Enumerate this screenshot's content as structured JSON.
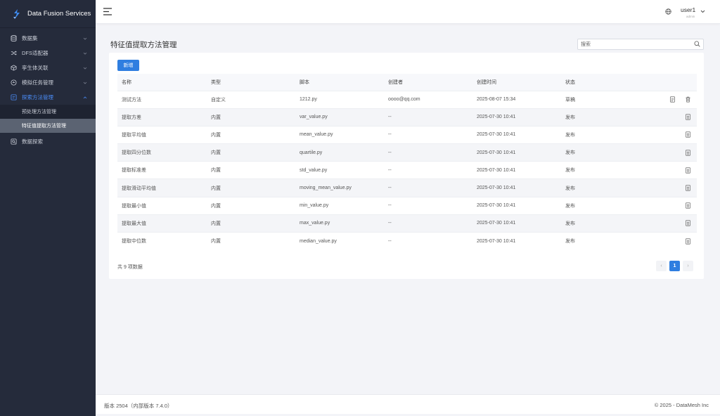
{
  "app": {
    "title": "Data Fusion Services"
  },
  "sidebar": {
    "items": [
      {
        "label": "数据集",
        "icon": "database-icon"
      },
      {
        "label": "DFS适配器",
        "icon": "shuffle-icon"
      },
      {
        "label": "孪生体关联",
        "icon": "cube-icon"
      },
      {
        "label": "模拟任务管理",
        "icon": "task-icon"
      },
      {
        "label": "探索方法管理",
        "icon": "method-icon",
        "active": true
      }
    ],
    "submenu": [
      {
        "label": "预处理方法管理"
      },
      {
        "label": "特征值提取方法管理",
        "selected": true
      }
    ],
    "extra": {
      "label": "数据探索",
      "icon": "explore-icon"
    }
  },
  "header": {
    "user": "user1",
    "user_sub": "admin"
  },
  "page": {
    "title": "特征值提取方法管理",
    "search_placeholder": "搜索",
    "add_label": "新增"
  },
  "table": {
    "columns": [
      "名称",
      "类型",
      "脚本",
      "创建者",
      "创建时间",
      "状态"
    ],
    "rows": [
      {
        "name": "测试方法",
        "type": "自定义",
        "script": "1212.py",
        "creator": "oooo@qq.com",
        "created": "2025-08-07 15:34",
        "status": "草稿",
        "deletable": true
      },
      {
        "name": "提取方差",
        "type": "内置",
        "script": "var_value.py",
        "creator": "--",
        "created": "2025-07-30 10:41",
        "status": "发布"
      },
      {
        "name": "提取平均值",
        "type": "内置",
        "script": "mean_value.py",
        "creator": "--",
        "created": "2025-07-30 10:41",
        "status": "发布"
      },
      {
        "name": "提取四分位数",
        "type": "内置",
        "script": "quartile.py",
        "creator": "--",
        "created": "2025-07-30 10:41",
        "status": "发布"
      },
      {
        "name": "提取标准差",
        "type": "内置",
        "script": "std_value.py",
        "creator": "--",
        "created": "2025-07-30 10:41",
        "status": "发布"
      },
      {
        "name": "提取滑动平均值",
        "type": "内置",
        "script": "moving_mean_value.py",
        "creator": "--",
        "created": "2025-07-30 10:41",
        "status": "发布"
      },
      {
        "name": "提取最小值",
        "type": "内置",
        "script": "min_value.py",
        "creator": "--",
        "created": "2025-07-30 10:41",
        "status": "发布"
      },
      {
        "name": "提取最大值",
        "type": "内置",
        "script": "max_value.py",
        "creator": "--",
        "created": "2025-07-30 10:41",
        "status": "发布"
      },
      {
        "name": "提取中位数",
        "type": "内置",
        "script": "median_value.py",
        "creator": "--",
        "created": "2025-07-30 10:41",
        "status": "发布"
      }
    ],
    "total_text": "共 9 项数据"
  },
  "pagination": {
    "current": "1",
    "prev": "‹",
    "next": "›"
  },
  "footer": {
    "version": "版本 2504（内部版本 7.4.0）",
    "copyright": "© 2025 - DataMesh Inc"
  },
  "colors": {
    "sidebar_bg": "#252b3b",
    "accent": "#2f7ee0",
    "active_menu": "#4a8cf7"
  }
}
